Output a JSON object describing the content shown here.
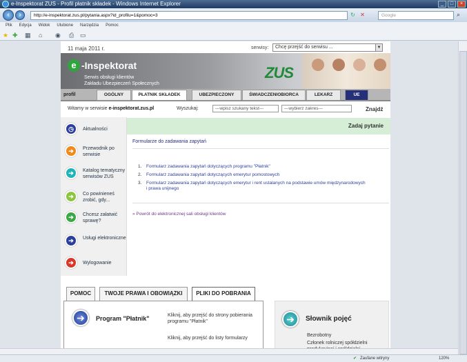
{
  "window": {
    "title": "e-Inspektorat ZUS - Profil płatnik składek - Windows Internet Explorer"
  },
  "browser": {
    "url": "http://e-inspektorat.zus.pl/pytania.aspx?id_profilu=1&pomoc=3",
    "search_placeholder": "Google",
    "menu": [
      "Plik",
      "Edycja",
      "Widok",
      "Ulubione",
      "Narzędzia",
      "Pomoc"
    ],
    "status_text": "Zaufane witryny",
    "zoom": "120%"
  },
  "site": {
    "date": "11 maja 2011 r.",
    "services_label": "serwisy:",
    "services_select": "Chcę przejść do serwisu ...",
    "logo_text": "-Inspektorat",
    "logo_e": "e",
    "subtitle_line1": "Serwis obsługi klientów",
    "subtitle_line2": "Zakładu Ubezpieczeń Społecznych",
    "zus_logo": "ZUS",
    "tabs": {
      "profil": "profil",
      "items": [
        "OGÓLNY",
        "PŁATNIK SKŁADEK",
        "UBEZPIECZONY",
        "ŚWIADCZENIOBIORCA",
        "LEKARZ",
        "UE"
      ]
    },
    "welcome_prefix": "Witamy w serwisie ",
    "welcome_site": "e-inspektorat.zus.pl",
    "search_label": "Wyszukaj:",
    "search_placeholder": "---wpisz szukany tekst---",
    "search_scope": "---wybierz zakres---",
    "search_button": "Znajdź"
  },
  "nav": [
    {
      "label": "Aktualności",
      "icon": "clock-icon",
      "color": "#2b3f9c"
    },
    {
      "label": "Przewodnik po serwisie",
      "icon": "arrow-right-icon",
      "color": "#f08a1c"
    },
    {
      "label": "Katalog tematyczny serwisów ZUS",
      "icon": "arrow-right-icon",
      "color": "#22b3b8"
    },
    {
      "label": "Co powinieneś zrobić, gdy...",
      "icon": "arrow-right-icon",
      "color": "#8cc63f"
    },
    {
      "label": "Chcesz załatwić sprawę?",
      "icon": "arrow-right-icon",
      "color": "#3aa845"
    },
    {
      "label": "Usługi elektroniczne",
      "icon": "arrow-right-icon",
      "color": "#2b3f9c"
    },
    {
      "label": "Wylogowanie",
      "icon": "arrow-right-icon",
      "color": "#d8372a"
    }
  ],
  "content": {
    "heading": "Zadaj pytanie",
    "form_title": "Formularze do zadawania zapytań",
    "links": [
      "Formularz zadawania zapytań dotyczących programu \"Płatnik\"",
      "Formularz zadawania zapytań dotyczących emerytur pomostowych",
      "Formularz zadawania zapytań dotyczących emerytur i rent ustalanych na podstawie umów międzynarodowych i prawa unijnego"
    ],
    "back_link": "» Powrót do elektronicznej sali obsługi klientów"
  },
  "bottom": {
    "tabs": [
      "POMOC",
      "TWOJE PRAWA I OBOWIĄZKI",
      "PLIKI DO POBRANIA"
    ],
    "program_title": "Program \"Płatnik\"",
    "click1": "Kliknij,  aby przejść do strony pobierania programu  \"Płatnik\"",
    "click2": "Kliknij,  aby przejść do listy formularzy",
    "slownik_title": "Słownik pojęć",
    "slownik_word1": "Bezrobotny",
    "slownik_word2": "Członek rolniczej spółdzielni produkcyjnej i spółdzielni"
  }
}
